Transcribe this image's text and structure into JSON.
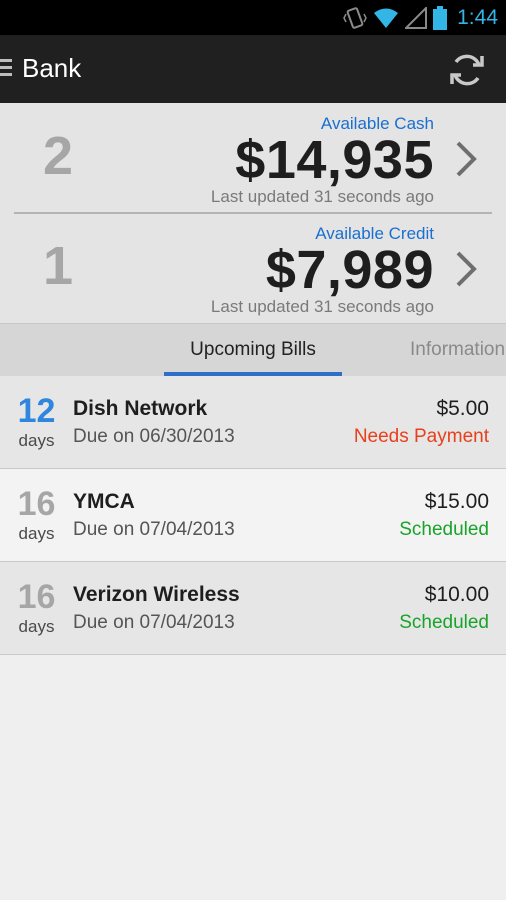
{
  "status_bar": {
    "time": "1:44",
    "icons": [
      "vibrate-icon",
      "wifi-icon",
      "signal-icon",
      "battery-icon"
    ]
  },
  "action_bar": {
    "title": "Bank",
    "menu_icon": "menu-icon",
    "refresh_icon": "refresh-icon"
  },
  "summary": {
    "cash": {
      "count": "2",
      "label": "Available Cash",
      "amount": "$14,935",
      "updated": "Last updated 31 seconds ago"
    },
    "credit": {
      "count": "1",
      "label": "Available Credit",
      "amount": "$7,989",
      "updated": "Last updated 31 seconds ago"
    }
  },
  "tabs": [
    {
      "label": "Upcoming Bills",
      "selected": true
    },
    {
      "label": "Information",
      "selected": false
    }
  ],
  "bills": [
    {
      "days": "12",
      "days_label": "days",
      "name": "Dish Network",
      "due": "Due on 06/30/2013",
      "amount": "$5.00",
      "status": "Needs Payment"
    },
    {
      "days": "16",
      "days_label": "days",
      "name": "YMCA",
      "due": "Due on 07/04/2013",
      "amount": "$15.00",
      "status": "Scheduled"
    },
    {
      "days": "16",
      "days_label": "days",
      "name": "Verizon Wireless",
      "due": "Due on 07/04/2013",
      "amount": "$10.00",
      "status": "Scheduled"
    }
  ],
  "colors": {
    "accent_blue": "#1a6fcf",
    "days_urgent": "#2e86de",
    "days_normal": "#a6a6a6",
    "status_needs_payment": "#e8401c",
    "status_scheduled": "#1aa32a",
    "action_bar": "#202020"
  }
}
